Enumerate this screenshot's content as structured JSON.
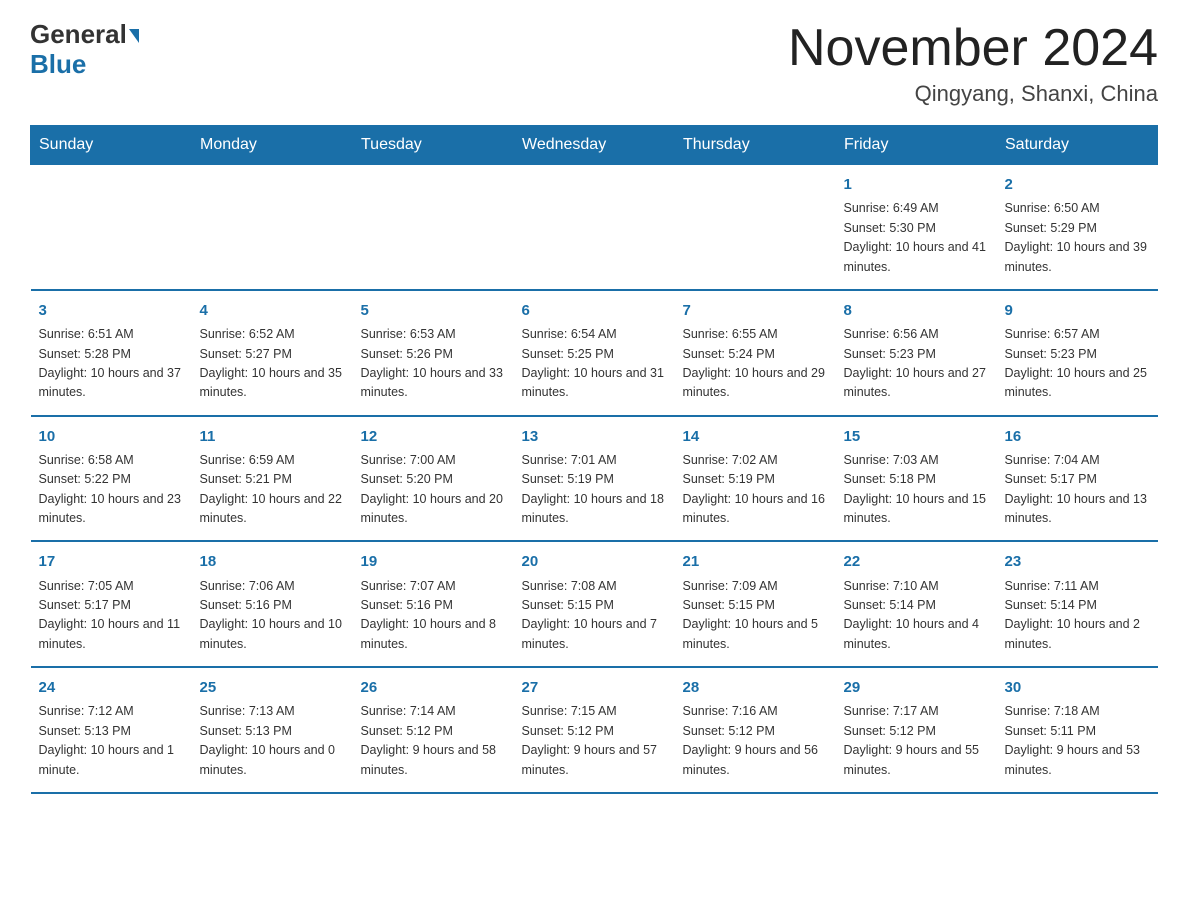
{
  "header": {
    "logo_general": "General",
    "logo_blue": "Blue",
    "title": "November 2024",
    "subtitle": "Qingyang, Shanxi, China"
  },
  "weekdays": [
    "Sunday",
    "Monday",
    "Tuesday",
    "Wednesday",
    "Thursday",
    "Friday",
    "Saturday"
  ],
  "rows": [
    {
      "cells": [
        {
          "day": "",
          "info": ""
        },
        {
          "day": "",
          "info": ""
        },
        {
          "day": "",
          "info": ""
        },
        {
          "day": "",
          "info": ""
        },
        {
          "day": "",
          "info": ""
        },
        {
          "day": "1",
          "info": "Sunrise: 6:49 AM\nSunset: 5:30 PM\nDaylight: 10 hours and 41 minutes."
        },
        {
          "day": "2",
          "info": "Sunrise: 6:50 AM\nSunset: 5:29 PM\nDaylight: 10 hours and 39 minutes."
        }
      ]
    },
    {
      "cells": [
        {
          "day": "3",
          "info": "Sunrise: 6:51 AM\nSunset: 5:28 PM\nDaylight: 10 hours and 37 minutes."
        },
        {
          "day": "4",
          "info": "Sunrise: 6:52 AM\nSunset: 5:27 PM\nDaylight: 10 hours and 35 minutes."
        },
        {
          "day": "5",
          "info": "Sunrise: 6:53 AM\nSunset: 5:26 PM\nDaylight: 10 hours and 33 minutes."
        },
        {
          "day": "6",
          "info": "Sunrise: 6:54 AM\nSunset: 5:25 PM\nDaylight: 10 hours and 31 minutes."
        },
        {
          "day": "7",
          "info": "Sunrise: 6:55 AM\nSunset: 5:24 PM\nDaylight: 10 hours and 29 minutes."
        },
        {
          "day": "8",
          "info": "Sunrise: 6:56 AM\nSunset: 5:23 PM\nDaylight: 10 hours and 27 minutes."
        },
        {
          "day": "9",
          "info": "Sunrise: 6:57 AM\nSunset: 5:23 PM\nDaylight: 10 hours and 25 minutes."
        }
      ]
    },
    {
      "cells": [
        {
          "day": "10",
          "info": "Sunrise: 6:58 AM\nSunset: 5:22 PM\nDaylight: 10 hours and 23 minutes."
        },
        {
          "day": "11",
          "info": "Sunrise: 6:59 AM\nSunset: 5:21 PM\nDaylight: 10 hours and 22 minutes."
        },
        {
          "day": "12",
          "info": "Sunrise: 7:00 AM\nSunset: 5:20 PM\nDaylight: 10 hours and 20 minutes."
        },
        {
          "day": "13",
          "info": "Sunrise: 7:01 AM\nSunset: 5:19 PM\nDaylight: 10 hours and 18 minutes."
        },
        {
          "day": "14",
          "info": "Sunrise: 7:02 AM\nSunset: 5:19 PM\nDaylight: 10 hours and 16 minutes."
        },
        {
          "day": "15",
          "info": "Sunrise: 7:03 AM\nSunset: 5:18 PM\nDaylight: 10 hours and 15 minutes."
        },
        {
          "day": "16",
          "info": "Sunrise: 7:04 AM\nSunset: 5:17 PM\nDaylight: 10 hours and 13 minutes."
        }
      ]
    },
    {
      "cells": [
        {
          "day": "17",
          "info": "Sunrise: 7:05 AM\nSunset: 5:17 PM\nDaylight: 10 hours and 11 minutes."
        },
        {
          "day": "18",
          "info": "Sunrise: 7:06 AM\nSunset: 5:16 PM\nDaylight: 10 hours and 10 minutes."
        },
        {
          "day": "19",
          "info": "Sunrise: 7:07 AM\nSunset: 5:16 PM\nDaylight: 10 hours and 8 minutes."
        },
        {
          "day": "20",
          "info": "Sunrise: 7:08 AM\nSunset: 5:15 PM\nDaylight: 10 hours and 7 minutes."
        },
        {
          "day": "21",
          "info": "Sunrise: 7:09 AM\nSunset: 5:15 PM\nDaylight: 10 hours and 5 minutes."
        },
        {
          "day": "22",
          "info": "Sunrise: 7:10 AM\nSunset: 5:14 PM\nDaylight: 10 hours and 4 minutes."
        },
        {
          "day": "23",
          "info": "Sunrise: 7:11 AM\nSunset: 5:14 PM\nDaylight: 10 hours and 2 minutes."
        }
      ]
    },
    {
      "cells": [
        {
          "day": "24",
          "info": "Sunrise: 7:12 AM\nSunset: 5:13 PM\nDaylight: 10 hours and 1 minute."
        },
        {
          "day": "25",
          "info": "Sunrise: 7:13 AM\nSunset: 5:13 PM\nDaylight: 10 hours and 0 minutes."
        },
        {
          "day": "26",
          "info": "Sunrise: 7:14 AM\nSunset: 5:12 PM\nDaylight: 9 hours and 58 minutes."
        },
        {
          "day": "27",
          "info": "Sunrise: 7:15 AM\nSunset: 5:12 PM\nDaylight: 9 hours and 57 minutes."
        },
        {
          "day": "28",
          "info": "Sunrise: 7:16 AM\nSunset: 5:12 PM\nDaylight: 9 hours and 56 minutes."
        },
        {
          "day": "29",
          "info": "Sunrise: 7:17 AM\nSunset: 5:12 PM\nDaylight: 9 hours and 55 minutes."
        },
        {
          "day": "30",
          "info": "Sunrise: 7:18 AM\nSunset: 5:11 PM\nDaylight: 9 hours and 53 minutes."
        }
      ]
    }
  ]
}
